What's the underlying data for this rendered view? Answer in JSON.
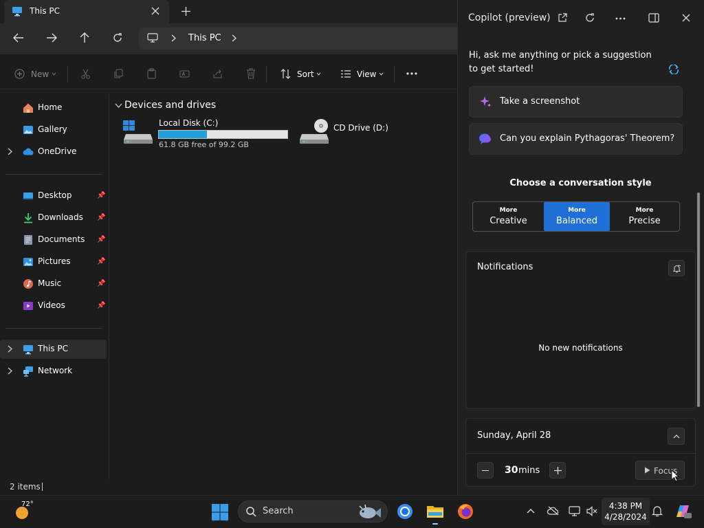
{
  "explorer": {
    "tab_title": "This PC",
    "breadcrumb": [
      "This PC"
    ],
    "toolbar": {
      "new_label": "New",
      "sort_label": "Sort",
      "view_label": "View"
    },
    "sidebar": {
      "home": "Home",
      "gallery": "Gallery",
      "onedrive": "OneDrive",
      "quick_access": [
        {
          "label": "Desktop"
        },
        {
          "label": "Downloads"
        },
        {
          "label": "Documents"
        },
        {
          "label": "Pictures"
        },
        {
          "label": "Music"
        },
        {
          "label": "Videos"
        }
      ],
      "this_pc": "This PC",
      "network": "Network"
    },
    "group_header": "Devices and drives",
    "drives": [
      {
        "name": "Local Disk (C:)",
        "free_text": "61.8 GB free of 99.2 GB",
        "used_fraction": 0.377
      },
      {
        "name": "CD Drive (D:)"
      }
    ],
    "status_items": "2 items"
  },
  "copilot": {
    "title": "Copilot (preview)",
    "greeting_line1": "Hi, ask me anything or pick a suggestion",
    "greeting_line2": "to get started!",
    "suggestions": [
      "Take a screenshot",
      "Can you explain Pythagoras' Theorem?"
    ],
    "style_heading": "Choose a conversation style",
    "styles": [
      {
        "small": "More",
        "big": "Creative"
      },
      {
        "small": "More",
        "big": "Balanced"
      },
      {
        "small": "More",
        "big": "Precise"
      }
    ],
    "selected_style": "Balanced",
    "notifications_title": "Notifications",
    "no_notifications": "No new notifications",
    "date_label": "Sunday, April 28",
    "focus_minutes": "30",
    "focus_unit": "mins",
    "focus_label": "Focus"
  },
  "taskbar": {
    "weather_temp": "72°",
    "search_label": "Search",
    "time": "4:38 PM",
    "date": "4/28/2024"
  },
  "colors": {
    "accent": "#4cc2ff",
    "selected_style": "#1f6fd6",
    "drive_bar": "#26a0da"
  }
}
